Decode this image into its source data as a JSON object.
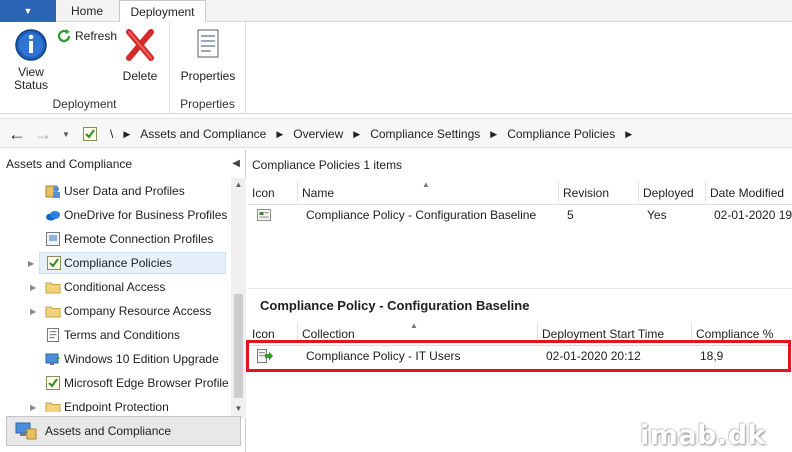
{
  "ribbon": {
    "tabs": [
      {
        "label": "Home",
        "active": false
      },
      {
        "label": "Deployment",
        "active": true
      }
    ],
    "groups": [
      {
        "label": "Deployment",
        "buttons": [
          {
            "line1": "View",
            "line2": "Status",
            "icon": "info-icon"
          },
          {
            "line1": "Refresh",
            "icon": "refresh-icon"
          },
          {
            "line1": "Delete",
            "icon": "delete-x-icon"
          }
        ]
      },
      {
        "label": "Properties",
        "buttons": [
          {
            "line1": "Properties",
            "icon": "properties-icon"
          }
        ]
      }
    ]
  },
  "address": {
    "root": "\\",
    "crumbs": [
      "Assets and Compliance",
      "Overview",
      "Compliance Settings",
      "Compliance Policies"
    ]
  },
  "nav": {
    "header": "Assets and Compliance",
    "items": [
      {
        "label": "User Data and Profiles",
        "icon": "user-data-icon"
      },
      {
        "label": "OneDrive for Business Profiles",
        "icon": "onedrive-cloud-icon"
      },
      {
        "label": "Remote Connection Profiles",
        "icon": "remote-connection-icon"
      },
      {
        "label": "Compliance Policies",
        "icon": "compliance-check-icon",
        "selected": true
      },
      {
        "label": "Conditional Access",
        "icon": "folder-icon"
      },
      {
        "label": "Company Resource Access",
        "icon": "folder-icon"
      },
      {
        "label": "Terms and Conditions",
        "icon": "document-icon"
      },
      {
        "label": "Windows 10 Edition Upgrade",
        "icon": "windows-upgrade-icon"
      },
      {
        "label": "Microsoft Edge Browser Profile",
        "icon": "edge-profile-icon"
      },
      {
        "label": "Endpoint Protection",
        "icon": "folder-icon"
      }
    ],
    "workspace": "Assets and Compliance"
  },
  "list": {
    "title": "Compliance Policies 1 items",
    "columns": [
      "Icon",
      "Name",
      "Revision",
      "Deployed",
      "Date Modified"
    ],
    "rows": [
      {
        "name": "Compliance Policy - Configuration Baseline",
        "revision": "5",
        "deployed": "Yes",
        "date_modified": "02-01-2020 19"
      }
    ]
  },
  "details": {
    "title": "Compliance Policy - Configuration Baseline",
    "columns": [
      "Icon",
      "Collection",
      "Deployment Start Time",
      "Compliance %"
    ],
    "rows": [
      {
        "collection": "Compliance Policy - IT Users",
        "start_time": "02-01-2020 20:12",
        "compliance": "18,9"
      }
    ]
  },
  "watermark": "imab.dk",
  "colors": {
    "accent": "#2b64b4",
    "highlight": "#e2151f",
    "selection": "#e5f0fb"
  }
}
